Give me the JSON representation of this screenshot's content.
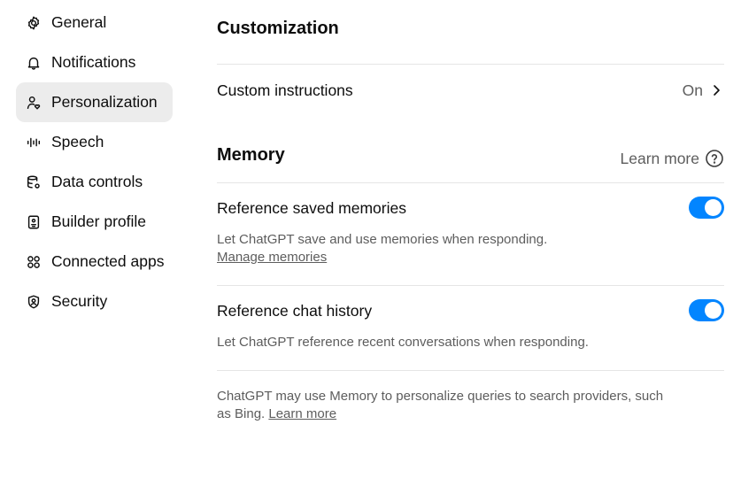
{
  "sidebar": {
    "items": [
      {
        "label": "General",
        "icon": "gear-icon"
      },
      {
        "label": "Notifications",
        "icon": "bell-icon"
      },
      {
        "label": "Personalization",
        "icon": "person-heart-icon",
        "active": true
      },
      {
        "label": "Speech",
        "icon": "waveform-icon"
      },
      {
        "label": "Data controls",
        "icon": "database-gear-icon"
      },
      {
        "label": "Builder profile",
        "icon": "id-badge-icon"
      },
      {
        "label": "Connected apps",
        "icon": "apps-icon"
      },
      {
        "label": "Security",
        "icon": "shield-person-icon"
      }
    ]
  },
  "customization": {
    "title": "Customization",
    "custom_instructions": {
      "label": "Custom instructions",
      "value": "On"
    }
  },
  "memory": {
    "title": "Memory",
    "learn_more": "Learn more",
    "reference_saved": {
      "label": "Reference saved memories",
      "description": "Let ChatGPT save and use memories when responding.",
      "link": "Manage memories",
      "enabled": true
    },
    "reference_history": {
      "label": "Reference chat history",
      "description": "Let ChatGPT reference recent conversations when responding.",
      "enabled": true
    },
    "footer": {
      "text": "ChatGPT may use Memory to personalize queries to search providers, such as Bing.",
      "link": "Learn more"
    }
  },
  "colors": {
    "accent": "#0285ff",
    "active_bg": "#ececec",
    "divider": "#e5e5e5",
    "muted_text": "#5d5d5d"
  }
}
